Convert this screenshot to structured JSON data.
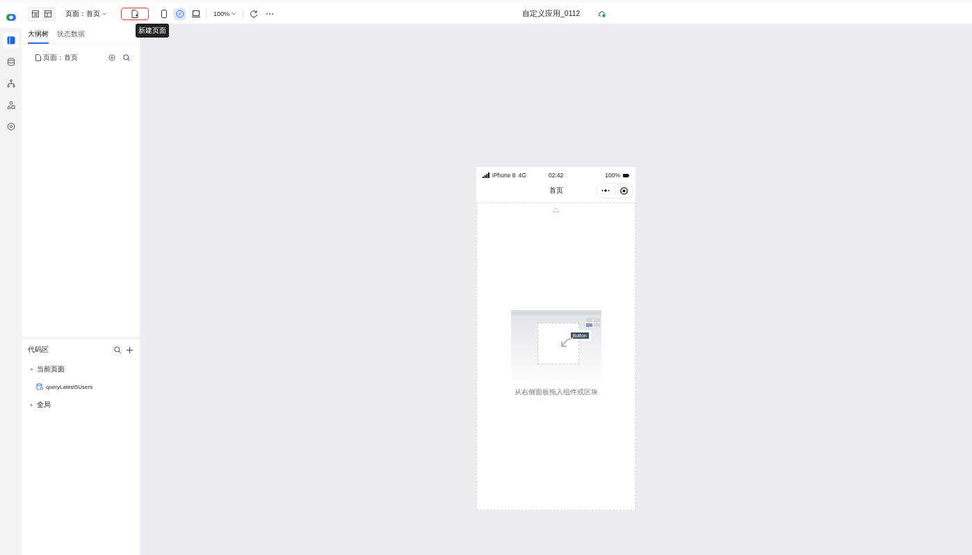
{
  "toolbar": {
    "view_toggles": [
      {
        "kind": "list",
        "selected": true
      },
      {
        "kind": "layout",
        "selected": false
      }
    ],
    "page_selector": "页面：首页",
    "tools": [
      {
        "kind": "new-page",
        "selected": false,
        "highlighted": true,
        "tooltip": "新建页面"
      },
      {
        "kind": "mobile",
        "selected": false,
        "highlighted": false
      },
      {
        "kind": "mini",
        "selected": true,
        "highlighted": false
      },
      {
        "kind": "desktop",
        "selected": false,
        "highlighted": false
      }
    ],
    "zoom": "100%",
    "app_title": "自定义应用_0112"
  },
  "rail": [
    {
      "kind": "outline",
      "selected": true
    },
    {
      "kind": "data",
      "selected": false
    },
    {
      "kind": "flow",
      "selected": false
    },
    {
      "kind": "components",
      "selected": false
    },
    {
      "kind": "settings",
      "selected": false
    }
  ],
  "outline_panel": {
    "tabs": [
      {
        "label": "大纲树",
        "selected": true
      },
      {
        "label": "状态数据",
        "selected": false
      }
    ],
    "items": [
      "页面：首页"
    ]
  },
  "code_panel": {
    "title": "代码区",
    "groups": [
      {
        "label": "当前页面",
        "expanded": true,
        "children": [
          "queryLatest5Users"
        ]
      },
      {
        "label": "全局",
        "expanded": false
      }
    ]
  },
  "phone": {
    "device": "iPhone 8",
    "network": "4G",
    "time": "02:42",
    "battery": "100%",
    "title": "首页",
    "illustration_button": "Button",
    "empty_hint": "从右侧面板拖入组件或区块"
  }
}
